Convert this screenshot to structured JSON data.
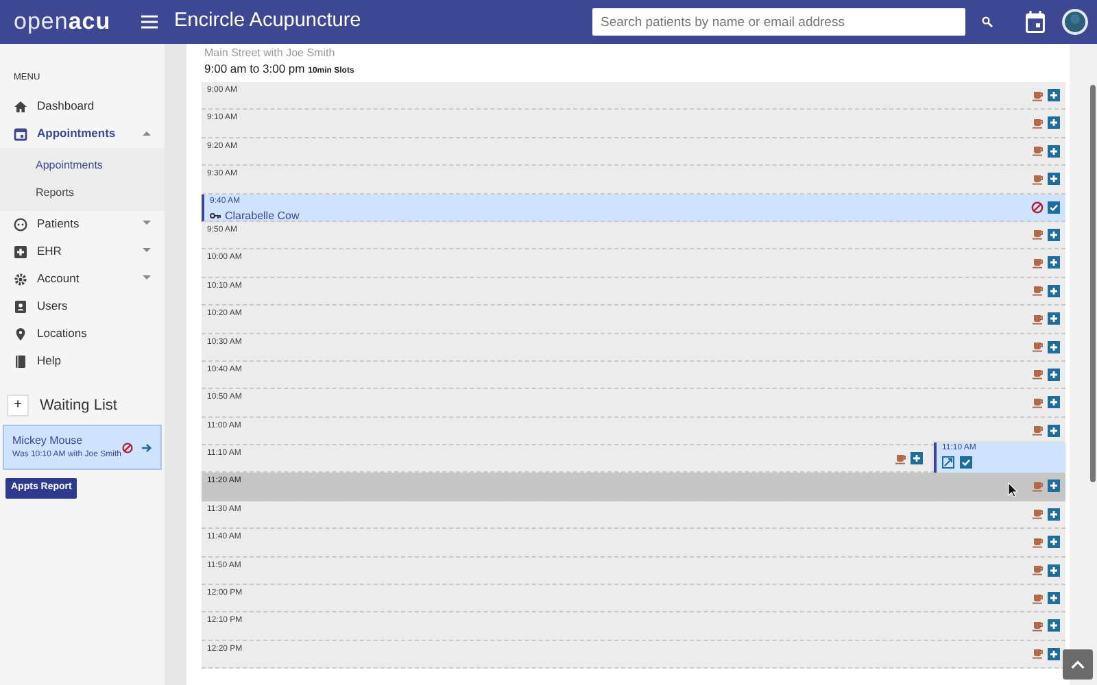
{
  "navbar": {
    "logo_left": "open",
    "logo_right": "acu",
    "title": "Encircle Acupuncture",
    "search": {
      "placeholder": "Search patients by name or email address"
    }
  },
  "sidebar": {
    "heading": "MENU",
    "items": [
      {
        "label": "Dashboard",
        "selected": false
      },
      {
        "label": "Appointments",
        "selected": true,
        "expanded": true,
        "children": [
          {
            "label": "Appointments",
            "selected": true
          },
          {
            "label": "Reports",
            "selected": false
          }
        ]
      },
      {
        "label": "Patients",
        "selected": false,
        "expanded": false
      },
      {
        "label": "EHR",
        "selected": false,
        "expanded": false
      },
      {
        "label": "Account",
        "selected": false,
        "expanded": false
      },
      {
        "label": "Users",
        "selected": false
      },
      {
        "label": "Locations",
        "selected": false
      },
      {
        "label": "Help",
        "selected": false
      }
    ],
    "waiting_list": {
      "add": "+",
      "title": "Waiting List",
      "entries": [
        {
          "name": "Mickey Mouse",
          "detail": "Was 10:10 AM with Joe Smith"
        }
      ]
    },
    "report_button": "Appts Report"
  },
  "schedule": {
    "subtitle": "Main Street with Joe Smith",
    "hours": "9:00 am to 3:00 pm",
    "slot_size": "10min Slots",
    "slots": [
      {
        "time": "9:00 AM",
        "kind": "open",
        "highlighted": false
      },
      {
        "time": "9:10 AM",
        "kind": "open",
        "highlighted": false
      },
      {
        "time": "9:20 AM",
        "kind": "open",
        "highlighted": false
      },
      {
        "time": "9:30 AM",
        "kind": "open",
        "highlighted": false
      },
      {
        "time": "9:40 AM",
        "kind": "booked",
        "patient": "Clarabelle Cow",
        "checked": true
      },
      {
        "time": "9:50 AM",
        "kind": "open",
        "highlighted": false
      },
      {
        "time": "10:00 AM",
        "kind": "open",
        "highlighted": false
      },
      {
        "time": "10:10 AM",
        "kind": "open",
        "highlighted": false
      },
      {
        "time": "10:20 AM",
        "kind": "open",
        "highlighted": false
      },
      {
        "time": "10:30 AM",
        "kind": "open",
        "highlighted": false
      },
      {
        "time": "10:40 AM",
        "kind": "open",
        "highlighted": false
      },
      {
        "time": "10:50 AM",
        "kind": "open",
        "highlighted": false
      },
      {
        "time": "11:00 AM",
        "kind": "open",
        "highlighted": false
      },
      {
        "time": "11:10 AM",
        "kind": "open",
        "highlighted": false,
        "dragged": {
          "time": "11:10 AM",
          "checked": true
        }
      },
      {
        "time": "11:20 AM",
        "kind": "open",
        "highlighted": true
      },
      {
        "time": "11:30 AM",
        "kind": "open",
        "highlighted": false
      },
      {
        "time": "11:40 AM",
        "kind": "open",
        "highlighted": false
      },
      {
        "time": "11:50 AM",
        "kind": "open",
        "highlighted": false
      },
      {
        "time": "12:00 PM",
        "kind": "open",
        "highlighted": false
      },
      {
        "time": "12:10 PM",
        "kind": "open",
        "highlighted": false
      },
      {
        "time": "12:20 PM",
        "kind": "open",
        "highlighted": false
      }
    ]
  }
}
